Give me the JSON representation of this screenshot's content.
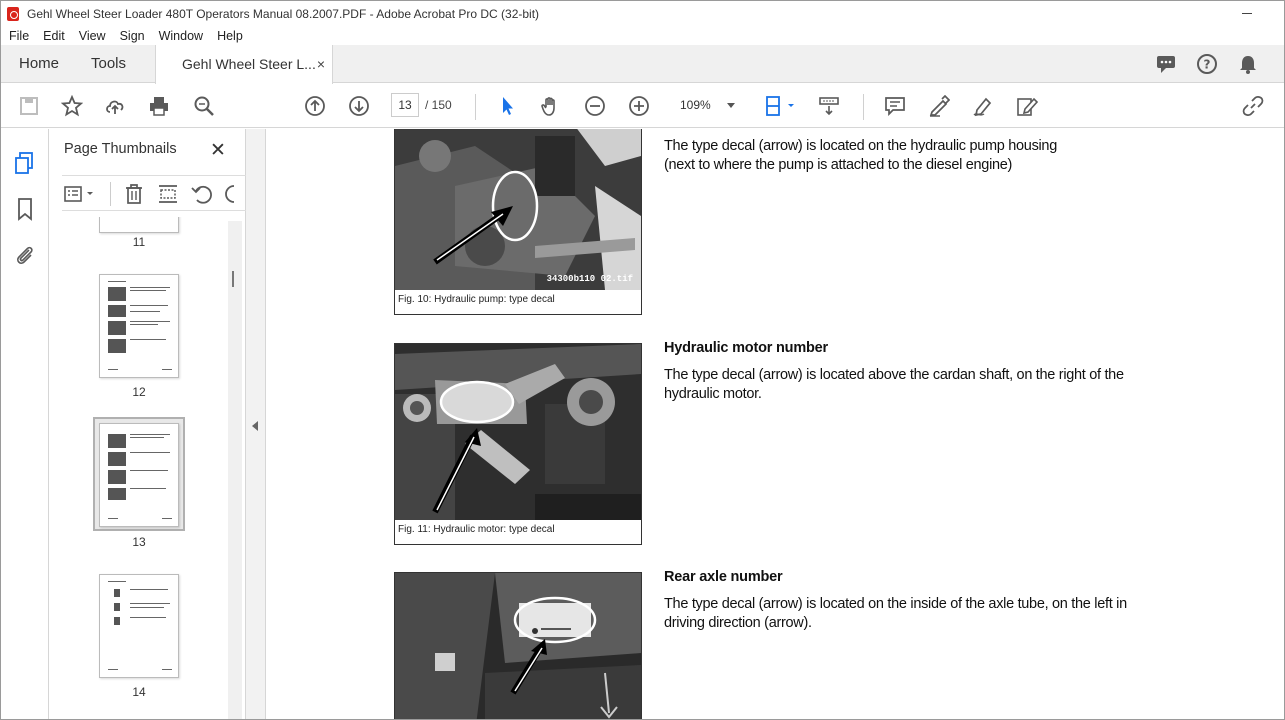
{
  "window": {
    "title": "Gehl Wheel Steer Loader 480T Operators Manual 08.2007.PDF - Adobe Acrobat Pro DC (32-bit)"
  },
  "menu": {
    "items": [
      "File",
      "Edit",
      "View",
      "Sign",
      "Window",
      "Help"
    ]
  },
  "tabs": {
    "home": "Home",
    "tools": "Tools",
    "document": "Gehl Wheel Steer L...",
    "close": "×"
  },
  "toolbar": {
    "current_page": "13",
    "page_total": "/  150",
    "zoom": "109%"
  },
  "panel": {
    "title": "Page Thumbnails",
    "close": "✕",
    "thumbnails": [
      {
        "number": "11"
      },
      {
        "number": "12"
      },
      {
        "number": "13",
        "selected": true
      },
      {
        "number": "14"
      }
    ]
  },
  "document": {
    "sections": [
      {
        "heading": "",
        "body": "The type decal (arrow) is located on the hydraulic pump housing\n(next to where the pump is attached to the diesel engine)",
        "caption": "Fig. 10:    Hydraulic pump: type decal",
        "photo_tag": "34300b110 02.tif"
      },
      {
        "heading": "Hydraulic motor number",
        "body": "The type decal (arrow) is located above the cardan shaft, on the right of the hydraulic motor.",
        "caption": "Fig. 11:    Hydraulic motor: type decal",
        "photo_tag": ""
      },
      {
        "heading": "Rear axle number",
        "body": "The type decal (arrow) is located on the inside of the axle tube, on the left in driving direction (arrow).",
        "caption": "",
        "photo_tag": ""
      }
    ]
  },
  "colors": {
    "accent": "#1a73e8",
    "acrobat_red": "#d9251c",
    "toolbar_icon": "#5a5a5a"
  }
}
